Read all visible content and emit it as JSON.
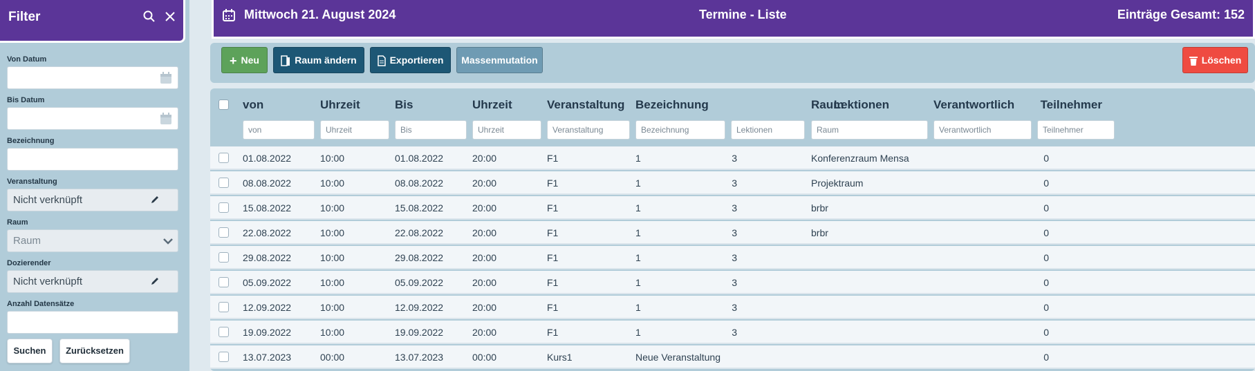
{
  "sidebar": {
    "title": "Filter",
    "von_datum_label": "Von Datum",
    "bis_datum_label": "Bis Datum",
    "bezeichnung_label": "Bezeichnung",
    "veranstaltung_label": "Veranstaltung",
    "veranstaltung_value": "Nicht verknüpft",
    "raum_label": "Raum",
    "raum_placeholder": "Raum",
    "dozierender_label": "Dozierender",
    "dozierender_value": "Nicht verknüpft",
    "anzahl_label": "Anzahl Datensätze",
    "search_button": "Suchen",
    "reset_button": "Zurücksetzen"
  },
  "header": {
    "date": "Mittwoch 21. August 2024",
    "title": "Termine - Liste",
    "total": "Einträge Gesamt: 152"
  },
  "toolbar": {
    "new": "Neu",
    "change_room": "Raum ändern",
    "export": "Exportieren",
    "mass": "Massenmutation",
    "delete": "Löschen"
  },
  "table": {
    "columns": [
      "von",
      "Uhrzeit",
      "Bis",
      "Uhrzeit",
      "Veranstaltung",
      "Bezeichnung",
      "Lektionen",
      "Raum",
      "Verantwortlich",
      "Teilnehmer"
    ],
    "filters": [
      "von",
      "Uhrzeit",
      "Bis",
      "Uhrzeit",
      "Veranstaltung",
      "Bezeichnung",
      "Lektionen",
      "Raum",
      "Verantwortlich",
      "Teilnehmer"
    ],
    "rows": [
      [
        "01.08.2022",
        "10:00",
        "01.08.2022",
        "20:00",
        "F1",
        "1",
        "3",
        "Konferenzraum Mensa",
        "",
        "0"
      ],
      [
        "08.08.2022",
        "10:00",
        "08.08.2022",
        "20:00",
        "F1",
        "1",
        "3",
        "Projektraum",
        "",
        "0"
      ],
      [
        "15.08.2022",
        "10:00",
        "15.08.2022",
        "20:00",
        "F1",
        "1",
        "3",
        "brbr",
        "",
        "0"
      ],
      [
        "22.08.2022",
        "10:00",
        "22.08.2022",
        "20:00",
        "F1",
        "1",
        "3",
        "brbr",
        "",
        "0"
      ],
      [
        "29.08.2022",
        "10:00",
        "29.08.2022",
        "20:00",
        "F1",
        "1",
        "3",
        "",
        "",
        "0"
      ],
      [
        "05.09.2022",
        "10:00",
        "05.09.2022",
        "20:00",
        "F1",
        "1",
        "3",
        "",
        "",
        "0"
      ],
      [
        "12.09.2022",
        "10:00",
        "12.09.2022",
        "20:00",
        "F1",
        "1",
        "3",
        "",
        "",
        "0"
      ],
      [
        "19.09.2022",
        "10:00",
        "19.09.2022",
        "20:00",
        "F1",
        "1",
        "3",
        "",
        "",
        "0"
      ],
      [
        "13.07.2023",
        "00:00",
        "13.07.2023",
        "00:00",
        "Kurs1",
        "Neue Veranstaltung",
        "",
        "",
        "",
        "0"
      ]
    ]
  },
  "colors": {
    "brand": "#5b3598",
    "panel": "#b1ccd9",
    "primary": "#1d5775",
    "success": "#5da25a",
    "danger": "#ef4b41"
  }
}
